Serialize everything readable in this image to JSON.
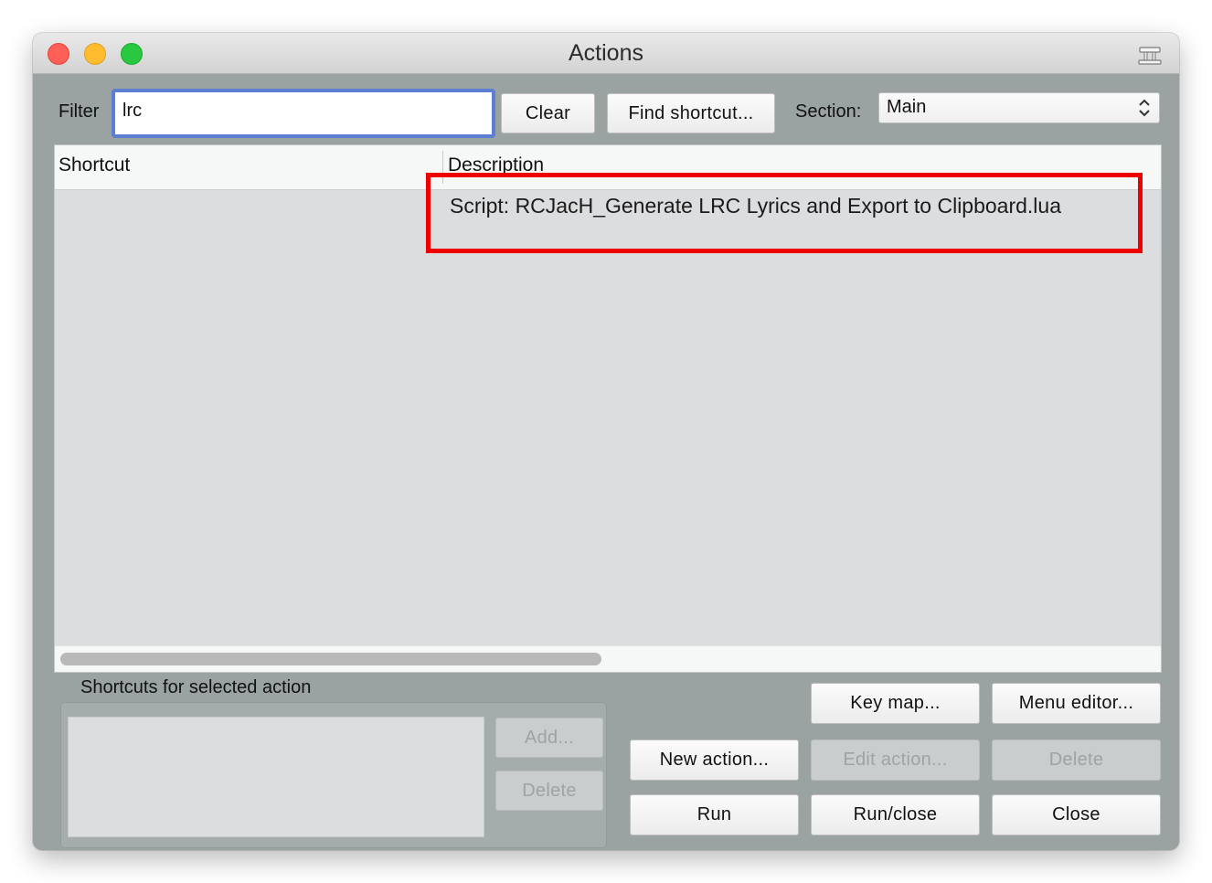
{
  "window": {
    "title": "Actions"
  },
  "filter": {
    "label": "Filter",
    "value": "lrc",
    "clear_label": "Clear",
    "find_shortcut_label": "Find shortcut..."
  },
  "section": {
    "label": "Section:",
    "selected": "Main"
  },
  "table": {
    "columns": [
      "Shortcut",
      "Description"
    ],
    "rows": [
      {
        "shortcut": "",
        "description": "Script: RCJacH_Generate LRC Lyrics and Export to Clipboard.lua"
      }
    ]
  },
  "annotation": {
    "color": "#ee0000"
  },
  "shortcuts_panel": {
    "title": "Shortcuts for selected action",
    "add_label": "Add...",
    "delete_label": "Delete"
  },
  "buttons": {
    "key_map": "Key map...",
    "menu_editor": "Menu editor...",
    "new_action": "New action...",
    "edit_action": "Edit action...",
    "delete": "Delete",
    "run": "Run",
    "run_close": "Run/close",
    "close": "Close"
  },
  "colors": {
    "focus_ring": "#5b7fd1",
    "window_bg": "#9aa2a2",
    "list_bg": "#dcdddf"
  }
}
